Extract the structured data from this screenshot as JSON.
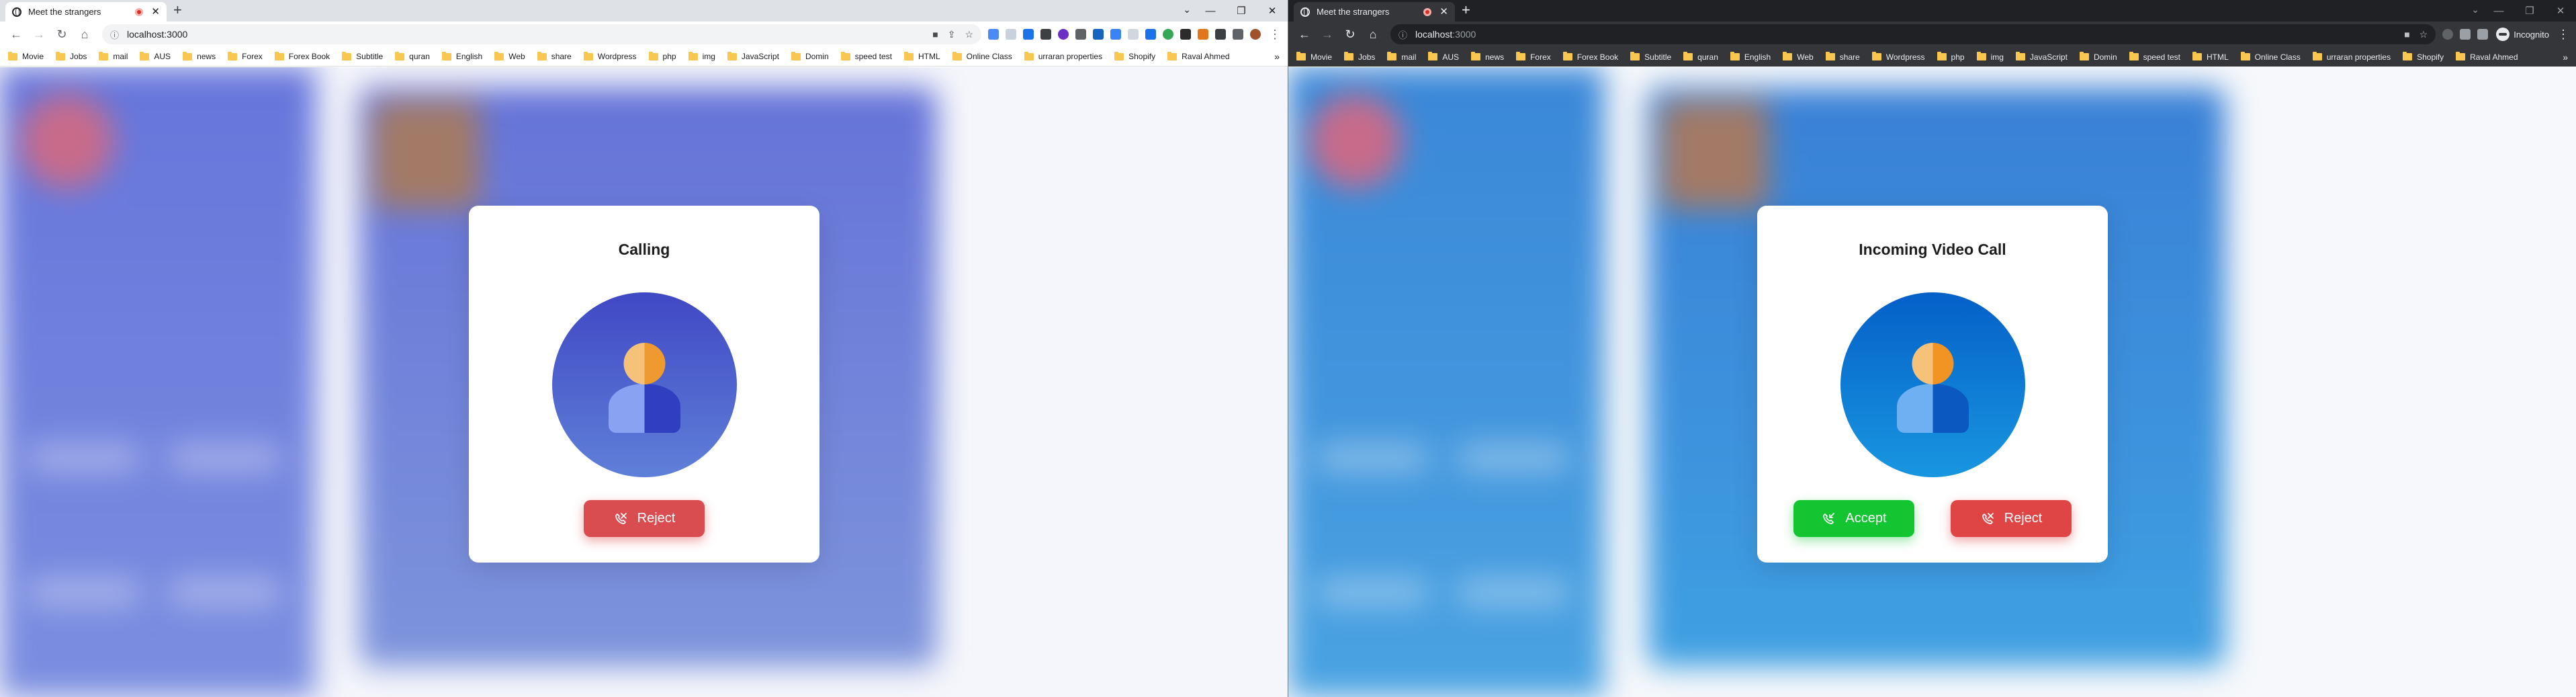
{
  "browser": {
    "tab_title": "Meet the strangers",
    "url_host": "localhost",
    "url_port": ":3000",
    "incognito_label": "Incognito",
    "bookmarks": [
      "Movie",
      "Jobs",
      "mail",
      "AUS",
      "news",
      "Forex",
      "Forex Book",
      "Subtitle",
      "quran",
      "English",
      "Web",
      "share",
      "Wordpress",
      "php",
      "img",
      "JavaScript",
      "Domin",
      "speed test",
      "HTML",
      "Online Class",
      "urraran properties",
      "Shopify",
      "Raval Ahmed"
    ]
  },
  "left": {
    "dialog_title": "Calling",
    "reject_label": "Reject"
  },
  "right": {
    "dialog_title": "Incoming Video Call",
    "accept_label": "Accept",
    "reject_label": "Reject"
  },
  "colors": {
    "reject": "#e04545",
    "accept": "#12c531",
    "left_avatar_bg": "#4048c4",
    "right_avatar_bg": "#0460c8",
    "user_head": "#f2a542",
    "user_body_light": "#7f9cf0",
    "user_body_dark": "#3445c8"
  },
  "icons": [
    "globe-icon",
    "record-icon",
    "close-icon",
    "plus-icon",
    "back-icon",
    "forward-icon",
    "reload-icon",
    "home-icon",
    "info-icon",
    "camera-icon",
    "share-icon",
    "star-icon",
    "extensions-icon",
    "menu-icon",
    "folder-icon",
    "user-avatar-icon",
    "phone-reject-icon",
    "phone-accept-icon"
  ]
}
